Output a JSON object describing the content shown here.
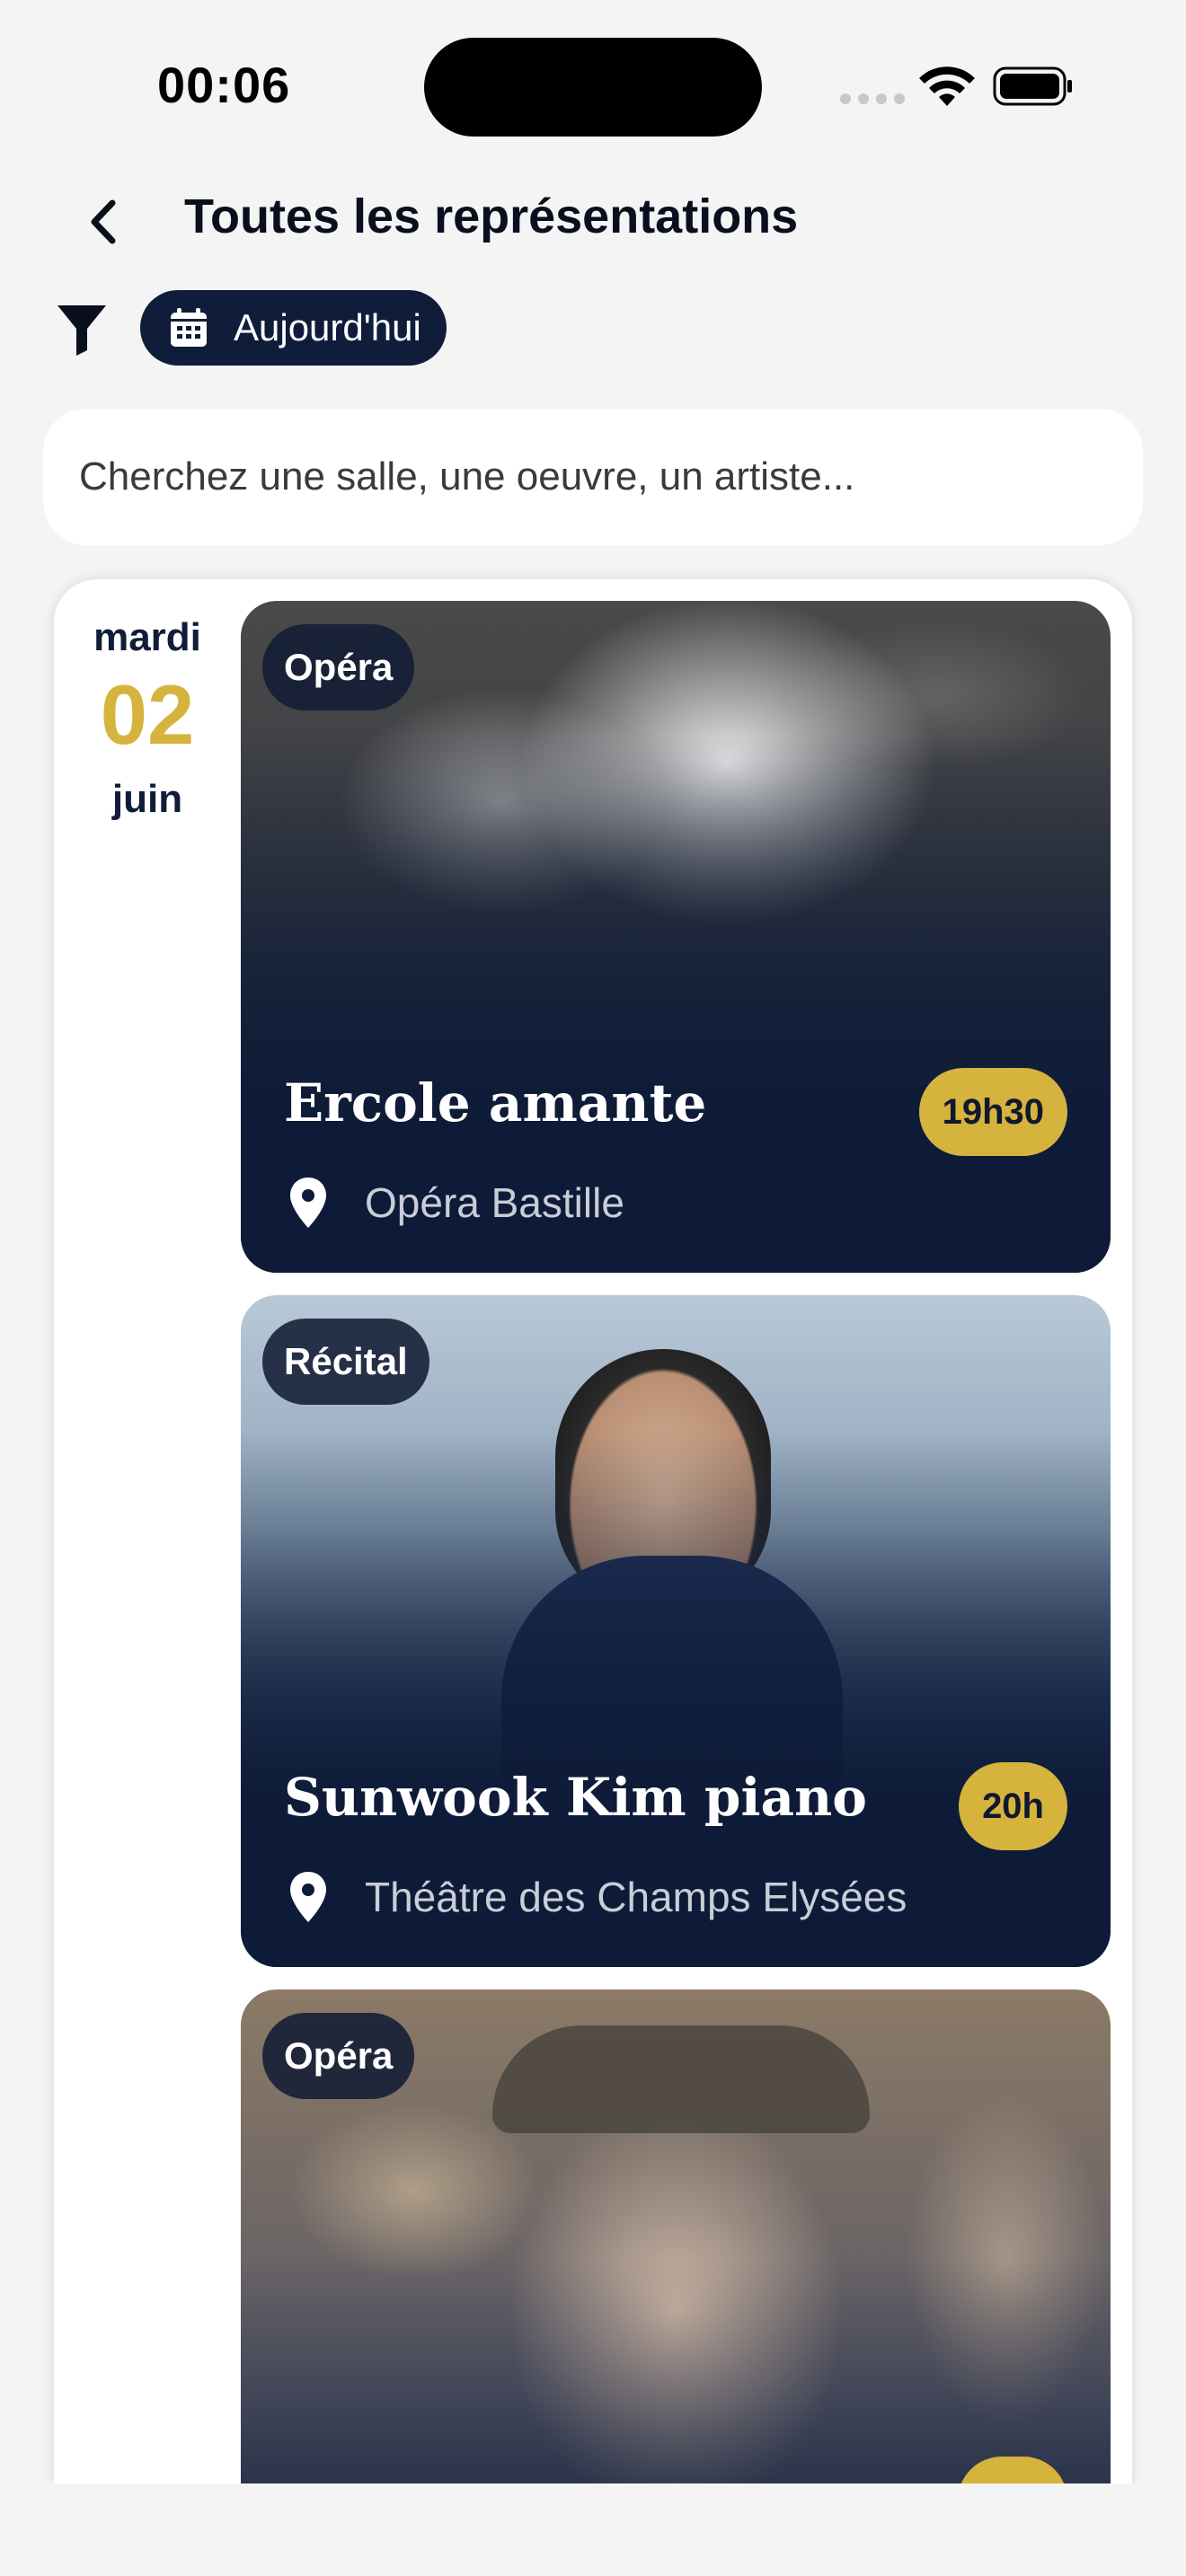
{
  "status_bar": {
    "time": "00:06"
  },
  "header": {
    "title": "Toutes les représentations"
  },
  "filters": {
    "date_chip_label": "Aujourd'hui"
  },
  "search": {
    "placeholder": "Cherchez une salle, une oeuvre, un artiste..."
  },
  "date": {
    "weekday": "mardi",
    "day": "02",
    "month": "juin"
  },
  "events": [
    {
      "category": "Opéra",
      "title": "Ercole amante",
      "time": "19h30",
      "venue": "Opéra Bastille"
    },
    {
      "category": "Récital",
      "title": "Sunwook Kim piano",
      "time": "20h",
      "venue": "Théâtre des Champs Elysées"
    },
    {
      "category": "Opéra",
      "title": "",
      "time": "",
      "venue": ""
    }
  ],
  "colors": {
    "navy": "#0f1d3a",
    "gold": "#d6b33d",
    "background": "#f4f4f4"
  },
  "icons": [
    "back-chevron-icon",
    "filter-funnel-icon",
    "calendar-icon",
    "location-pin-icon",
    "wifi-icon",
    "battery-icon"
  ]
}
